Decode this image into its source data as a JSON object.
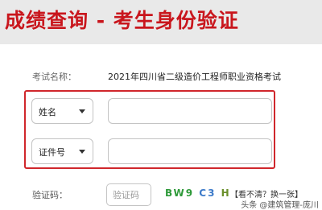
{
  "header": {
    "title": "成绩查询 - 考生身份验证"
  },
  "exam": {
    "label": "考试名称：",
    "value": "2021年四川省二级造价工程师职业资格考试"
  },
  "identity": {
    "name_select": {
      "selected": "姓名"
    },
    "id_select": {
      "selected": "证件号"
    }
  },
  "captcha": {
    "label": "验证码：",
    "placeholder": "验证码",
    "image_text_1": "BW9",
    "image_text_2": "C3",
    "image_text_3": "H",
    "refresh_label": "【看不清？换一张】"
  },
  "watermark": {
    "text": "头条 @建筑管理-庞川"
  },
  "colors": {
    "title": "#c9161d",
    "highlight_box": "#d0272c",
    "header_background": "#e9e9e9"
  }
}
